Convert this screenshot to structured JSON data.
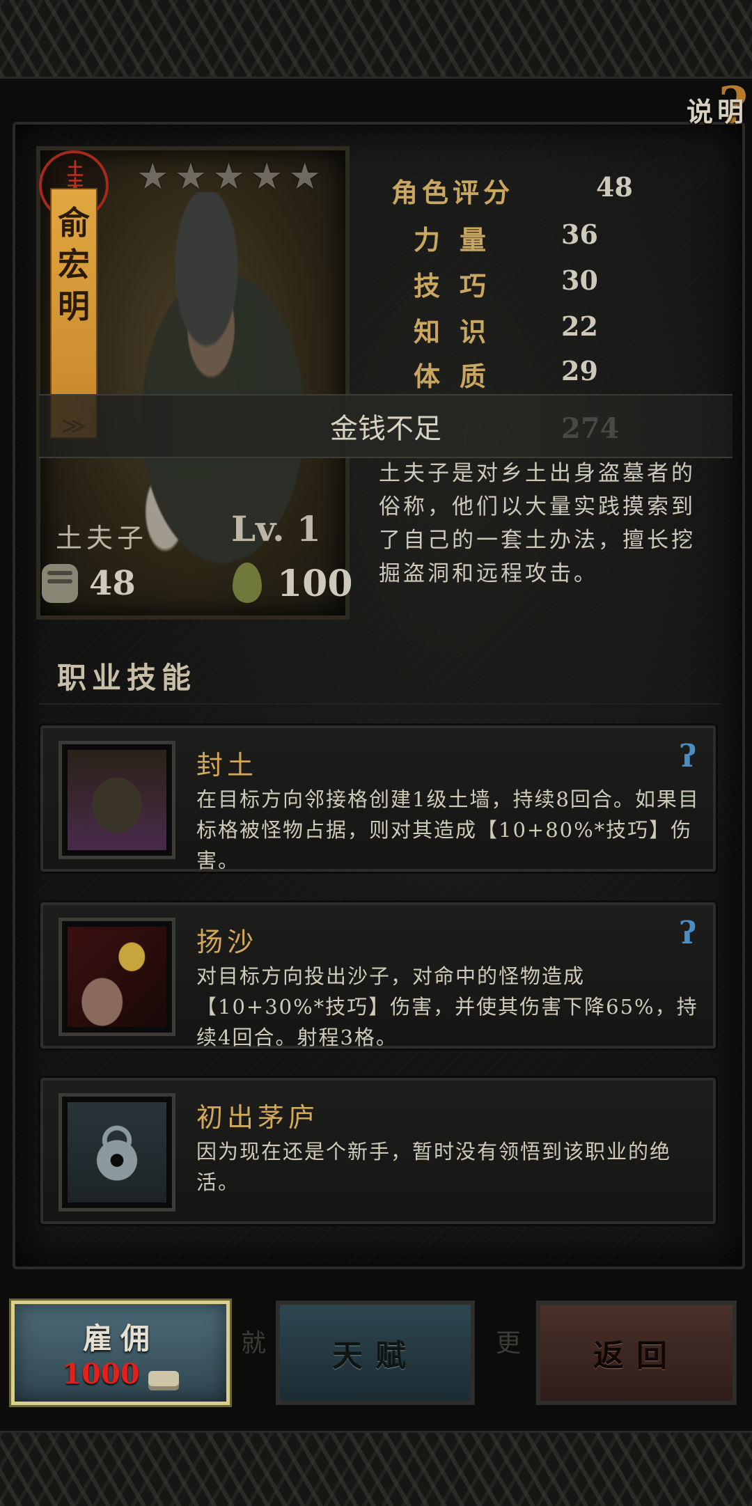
{
  "help": {
    "label": "说明",
    "mark": "?"
  },
  "hero": {
    "seal": "土夫子",
    "name_chars": [
      "俞",
      "宏",
      "明"
    ],
    "stars": 5,
    "class_name": "土夫子",
    "level": "Lv. 1",
    "attack": "48",
    "hp": "100"
  },
  "stats": [
    {
      "label": "角色评分",
      "value": "48"
    },
    {
      "label": "力量",
      "value": "36"
    },
    {
      "label": "技巧",
      "value": "30"
    },
    {
      "label": "知识",
      "value": "22"
    },
    {
      "label": "体质",
      "value": "29"
    }
  ],
  "hidden_stat": {
    "label": "价格",
    "value": "274"
  },
  "toast": "金钱不足",
  "description": "土夫子是对乡土出身盗墓者的俗称，他们以大量实践摸索到了自己的一套土办法，擅长挖掘盗洞和远程攻击。",
  "section_title": "职业技能",
  "skills": [
    {
      "name": "封土",
      "text": "在目标方向邻接格创建1级土墙，持续8回合。如果目标格被怪物占据，则对其造成【10+80%*技巧】伤害。",
      "icon": "earth-wall-icon"
    },
    {
      "name": "扬沙",
      "text": "对目标方向投出沙子，对命中的怪物造成【10+30%*技巧】伤害，并使其伤害下降65%，持续4回合。射程3格。",
      "icon": "throw-sand-icon"
    },
    {
      "name": "初出茅庐",
      "text": "因为现在还是个新手，暂时没有领悟到该职业的绝活。",
      "icon": "locked-skill-icon"
    }
  ],
  "buttons": {
    "hire": {
      "label": "雇佣",
      "cost": "1000"
    },
    "talent": {
      "label": "天赋"
    },
    "back": {
      "label": "返回"
    }
  },
  "ghost_text": {
    "left": "就",
    "right": "更"
  },
  "colors": {
    "accent_gold": "#c9a760",
    "cost_red": "#e3201a",
    "skill_blue": "#4a8ec4"
  }
}
